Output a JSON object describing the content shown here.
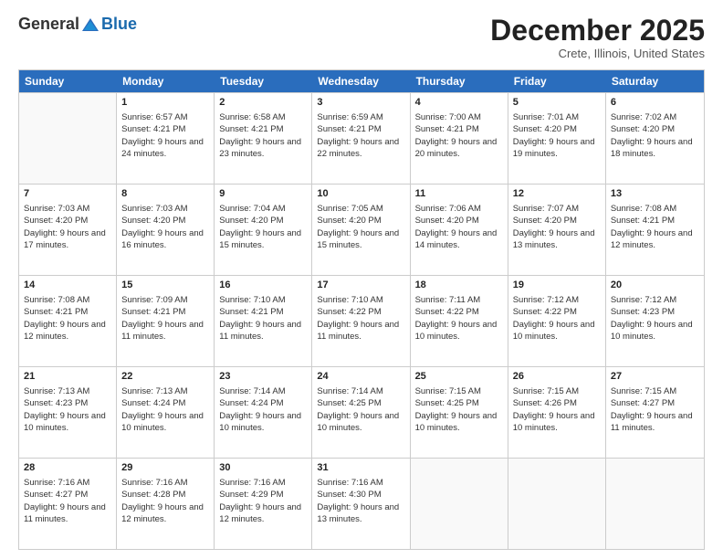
{
  "header": {
    "logo_general": "General",
    "logo_blue": "Blue",
    "month_title": "December 2025",
    "location": "Crete, Illinois, United States"
  },
  "days_of_week": [
    "Sunday",
    "Monday",
    "Tuesday",
    "Wednesday",
    "Thursday",
    "Friday",
    "Saturday"
  ],
  "weeks": [
    [
      {
        "day": "",
        "sunrise": "",
        "sunset": "",
        "daylight": ""
      },
      {
        "day": "1",
        "sunrise": "Sunrise: 6:57 AM",
        "sunset": "Sunset: 4:21 PM",
        "daylight": "Daylight: 9 hours and 24 minutes."
      },
      {
        "day": "2",
        "sunrise": "Sunrise: 6:58 AM",
        "sunset": "Sunset: 4:21 PM",
        "daylight": "Daylight: 9 hours and 23 minutes."
      },
      {
        "day": "3",
        "sunrise": "Sunrise: 6:59 AM",
        "sunset": "Sunset: 4:21 PM",
        "daylight": "Daylight: 9 hours and 22 minutes."
      },
      {
        "day": "4",
        "sunrise": "Sunrise: 7:00 AM",
        "sunset": "Sunset: 4:21 PM",
        "daylight": "Daylight: 9 hours and 20 minutes."
      },
      {
        "day": "5",
        "sunrise": "Sunrise: 7:01 AM",
        "sunset": "Sunset: 4:20 PM",
        "daylight": "Daylight: 9 hours and 19 minutes."
      },
      {
        "day": "6",
        "sunrise": "Sunrise: 7:02 AM",
        "sunset": "Sunset: 4:20 PM",
        "daylight": "Daylight: 9 hours and 18 minutes."
      }
    ],
    [
      {
        "day": "7",
        "sunrise": "Sunrise: 7:03 AM",
        "sunset": "Sunset: 4:20 PM",
        "daylight": "Daylight: 9 hours and 17 minutes."
      },
      {
        "day": "8",
        "sunrise": "Sunrise: 7:03 AM",
        "sunset": "Sunset: 4:20 PM",
        "daylight": "Daylight: 9 hours and 16 minutes."
      },
      {
        "day": "9",
        "sunrise": "Sunrise: 7:04 AM",
        "sunset": "Sunset: 4:20 PM",
        "daylight": "Daylight: 9 hours and 15 minutes."
      },
      {
        "day": "10",
        "sunrise": "Sunrise: 7:05 AM",
        "sunset": "Sunset: 4:20 PM",
        "daylight": "Daylight: 9 hours and 15 minutes."
      },
      {
        "day": "11",
        "sunrise": "Sunrise: 7:06 AM",
        "sunset": "Sunset: 4:20 PM",
        "daylight": "Daylight: 9 hours and 14 minutes."
      },
      {
        "day": "12",
        "sunrise": "Sunrise: 7:07 AM",
        "sunset": "Sunset: 4:20 PM",
        "daylight": "Daylight: 9 hours and 13 minutes."
      },
      {
        "day": "13",
        "sunrise": "Sunrise: 7:08 AM",
        "sunset": "Sunset: 4:21 PM",
        "daylight": "Daylight: 9 hours and 12 minutes."
      }
    ],
    [
      {
        "day": "14",
        "sunrise": "Sunrise: 7:08 AM",
        "sunset": "Sunset: 4:21 PM",
        "daylight": "Daylight: 9 hours and 12 minutes."
      },
      {
        "day": "15",
        "sunrise": "Sunrise: 7:09 AM",
        "sunset": "Sunset: 4:21 PM",
        "daylight": "Daylight: 9 hours and 11 minutes."
      },
      {
        "day": "16",
        "sunrise": "Sunrise: 7:10 AM",
        "sunset": "Sunset: 4:21 PM",
        "daylight": "Daylight: 9 hours and 11 minutes."
      },
      {
        "day": "17",
        "sunrise": "Sunrise: 7:10 AM",
        "sunset": "Sunset: 4:22 PM",
        "daylight": "Daylight: 9 hours and 11 minutes."
      },
      {
        "day": "18",
        "sunrise": "Sunrise: 7:11 AM",
        "sunset": "Sunset: 4:22 PM",
        "daylight": "Daylight: 9 hours and 10 minutes."
      },
      {
        "day": "19",
        "sunrise": "Sunrise: 7:12 AM",
        "sunset": "Sunset: 4:22 PM",
        "daylight": "Daylight: 9 hours and 10 minutes."
      },
      {
        "day": "20",
        "sunrise": "Sunrise: 7:12 AM",
        "sunset": "Sunset: 4:23 PM",
        "daylight": "Daylight: 9 hours and 10 minutes."
      }
    ],
    [
      {
        "day": "21",
        "sunrise": "Sunrise: 7:13 AM",
        "sunset": "Sunset: 4:23 PM",
        "daylight": "Daylight: 9 hours and 10 minutes."
      },
      {
        "day": "22",
        "sunrise": "Sunrise: 7:13 AM",
        "sunset": "Sunset: 4:24 PM",
        "daylight": "Daylight: 9 hours and 10 minutes."
      },
      {
        "day": "23",
        "sunrise": "Sunrise: 7:14 AM",
        "sunset": "Sunset: 4:24 PM",
        "daylight": "Daylight: 9 hours and 10 minutes."
      },
      {
        "day": "24",
        "sunrise": "Sunrise: 7:14 AM",
        "sunset": "Sunset: 4:25 PM",
        "daylight": "Daylight: 9 hours and 10 minutes."
      },
      {
        "day": "25",
        "sunrise": "Sunrise: 7:15 AM",
        "sunset": "Sunset: 4:25 PM",
        "daylight": "Daylight: 9 hours and 10 minutes."
      },
      {
        "day": "26",
        "sunrise": "Sunrise: 7:15 AM",
        "sunset": "Sunset: 4:26 PM",
        "daylight": "Daylight: 9 hours and 10 minutes."
      },
      {
        "day": "27",
        "sunrise": "Sunrise: 7:15 AM",
        "sunset": "Sunset: 4:27 PM",
        "daylight": "Daylight: 9 hours and 11 minutes."
      }
    ],
    [
      {
        "day": "28",
        "sunrise": "Sunrise: 7:16 AM",
        "sunset": "Sunset: 4:27 PM",
        "daylight": "Daylight: 9 hours and 11 minutes."
      },
      {
        "day": "29",
        "sunrise": "Sunrise: 7:16 AM",
        "sunset": "Sunset: 4:28 PM",
        "daylight": "Daylight: 9 hours and 12 minutes."
      },
      {
        "day": "30",
        "sunrise": "Sunrise: 7:16 AM",
        "sunset": "Sunset: 4:29 PM",
        "daylight": "Daylight: 9 hours and 12 minutes."
      },
      {
        "day": "31",
        "sunrise": "Sunrise: 7:16 AM",
        "sunset": "Sunset: 4:30 PM",
        "daylight": "Daylight: 9 hours and 13 minutes."
      },
      {
        "day": "",
        "sunrise": "",
        "sunset": "",
        "daylight": ""
      },
      {
        "day": "",
        "sunrise": "",
        "sunset": "",
        "daylight": ""
      },
      {
        "day": "",
        "sunrise": "",
        "sunset": "",
        "daylight": ""
      }
    ]
  ]
}
